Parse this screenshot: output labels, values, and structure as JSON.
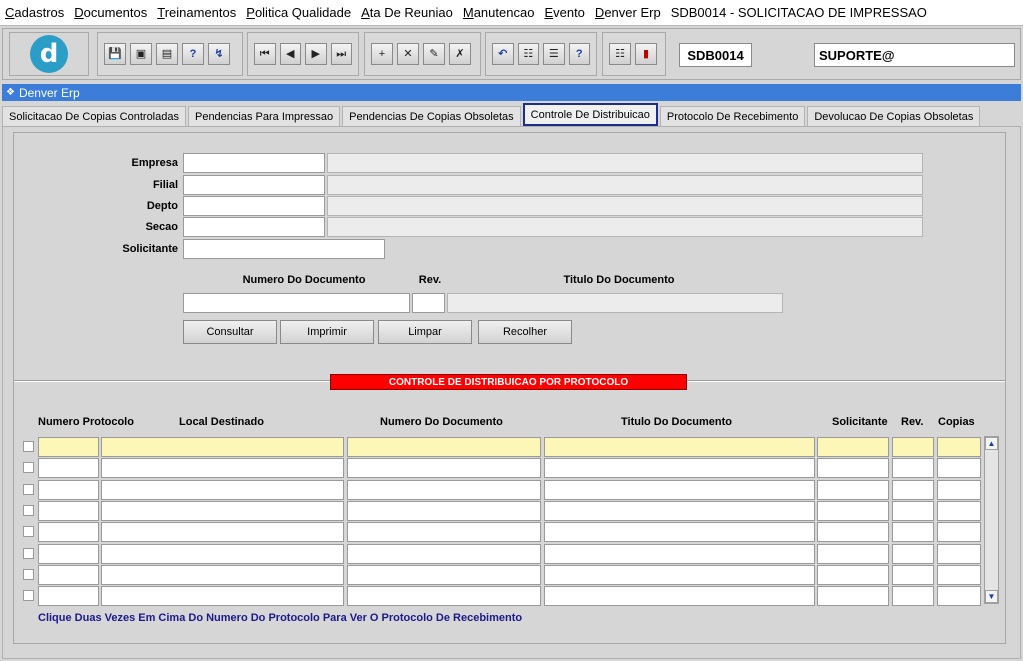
{
  "menu": [
    "Cadastros",
    "Documentos",
    "Treinamentos",
    "Politica Qualidade",
    "Ata De Reuniao",
    "Manutencao",
    "Evento",
    "Denver Erp",
    "SDB0014 - SOLICITACAO DE IMPRESSAO"
  ],
  "toolbar": {
    "logo_letter": "d",
    "form_code": "SDB0014",
    "user": "SUPORTE@",
    "icons": [
      "save-icon",
      "window-icon",
      "print-icon",
      "help-query-icon",
      "execute-query-icon",
      "first-record-icon",
      "previous-record-icon",
      "next-record-icon",
      "last-record-icon",
      "insert-record-icon",
      "delete-record-icon",
      "edit-icon",
      "clear-icon",
      "undo-icon",
      "clipboard-icon",
      "keys-icon",
      "help-icon",
      "menu-icon",
      "exit-icon"
    ]
  },
  "window_title": "Denver Erp",
  "tabs": [
    "Solicitacao De Copias Controladas",
    "Pendencias Para Impressao",
    "Pendencias De Copias Obsoletas",
    "Controle De Distribuicao",
    "Protocolo De Recebimento",
    "Devolucao De Copias Obsoletas"
  ],
  "active_tab": "Controle De Distribuicao",
  "form": {
    "empresa_label": "Empresa",
    "filial_label": "Filial",
    "depto_label": "Depto",
    "secao_label": "Secao",
    "solicitante_label": "Solicitante",
    "numero_documento_label": "Numero Do Documento",
    "rev_label": "Rev.",
    "titulo_documento_label": "Titulo Do Documento"
  },
  "buttons": {
    "consultar": "Consultar",
    "imprimir": "Imprimir",
    "limpar": "Limpar",
    "recolher": "Recolher"
  },
  "section_title": "CONTROLE DE DISTRIBUICAO POR PROTOCOLO",
  "table": {
    "columns": [
      "Numero Protocolo",
      "Local Destinado",
      "Numero Do Documento",
      "Titulo Do Documento",
      "Solicitante",
      "Rev.",
      "Copias"
    ],
    "row_count": 8
  },
  "footer_note": "Clique Duas Vezes Em Cima Do Numero Do Protocolo Para Ver O Protocolo De Recebimento",
  "colors": {
    "title_bar": "#3b7dd8",
    "section_title_bg": "#ff0000",
    "active_row_bg": "#fdf7b7",
    "active_tab_border": "#1c2d8c"
  }
}
